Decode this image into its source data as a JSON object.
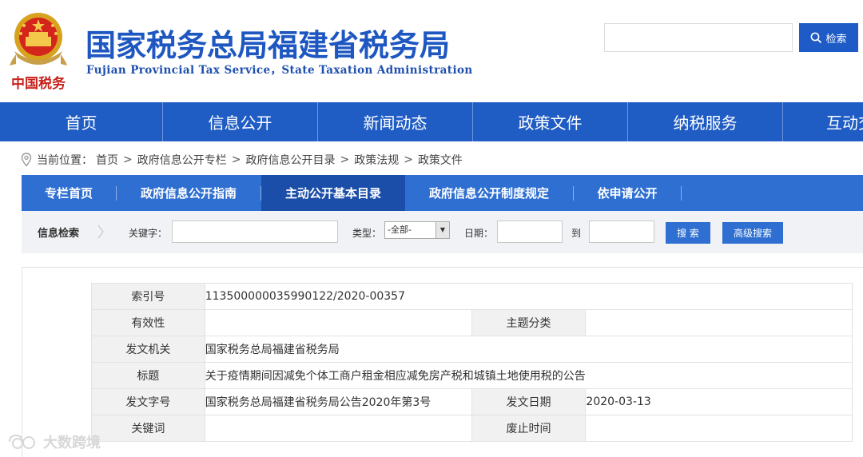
{
  "header": {
    "title": "国家税务总局福建省税务局",
    "subtitle": "Fujian Provincial Tax Service，State Taxation Administration",
    "emblem_text": "中国税务",
    "search": {
      "value": "",
      "button_label": "检索"
    }
  },
  "nav": [
    "首页",
    "信息公开",
    "新闻动态",
    "政策文件",
    "纳税服务",
    "互动交流"
  ],
  "breadcrumb": {
    "label": "当前位置：",
    "items": [
      "首页",
      "政府信息公开专栏",
      "政府信息公开目录",
      "政策法规",
      "政策文件"
    ],
    "separator": ">"
  },
  "subnav": [
    {
      "label": "专栏首页",
      "active": false
    },
    {
      "label": "政府信息公开指南",
      "active": false
    },
    {
      "label": "主动公开基本目录",
      "active": true
    },
    {
      "label": "政府信息公开制度规定",
      "active": false
    },
    {
      "label": "依申请公开",
      "active": false
    }
  ],
  "filter": {
    "label": "信息检索",
    "keyword_label": "关键字：",
    "keyword_value": "",
    "type_label": "类型：",
    "type_value": "-全部-",
    "date_label": "日期：",
    "to_label": "到",
    "date_from": "",
    "date_to": "",
    "search_button": "搜 索",
    "advanced_button": "高级搜索"
  },
  "info": {
    "index_no_label": "索引号",
    "index_no": "113500000035990122/2020-00357",
    "validity_label": "有效性",
    "validity": "",
    "topic_label": "主题分类",
    "topic": "",
    "issuer_label": "发文机关",
    "issuer": "国家税务总局福建省税务局",
    "title_label": "标题",
    "title": "关于疫情期间因减免个体工商户租金相应减免房产税和城镇土地使用税的公告",
    "doc_no_label": "发文字号",
    "doc_no": "国家税务总局福建省税务局公告2020年第3号",
    "date_label": "发文日期",
    "date": "2020-03-13",
    "keywords_label": "关键词",
    "keywords": "",
    "repeal_label": "废止时间",
    "repeal": ""
  },
  "watermark": "大数跨境",
  "colors": {
    "brand": "#1f5cc4",
    "subnav": "#2e6fd1",
    "subnav_active": "#1b4ea9",
    "title": "#1e57c1"
  }
}
